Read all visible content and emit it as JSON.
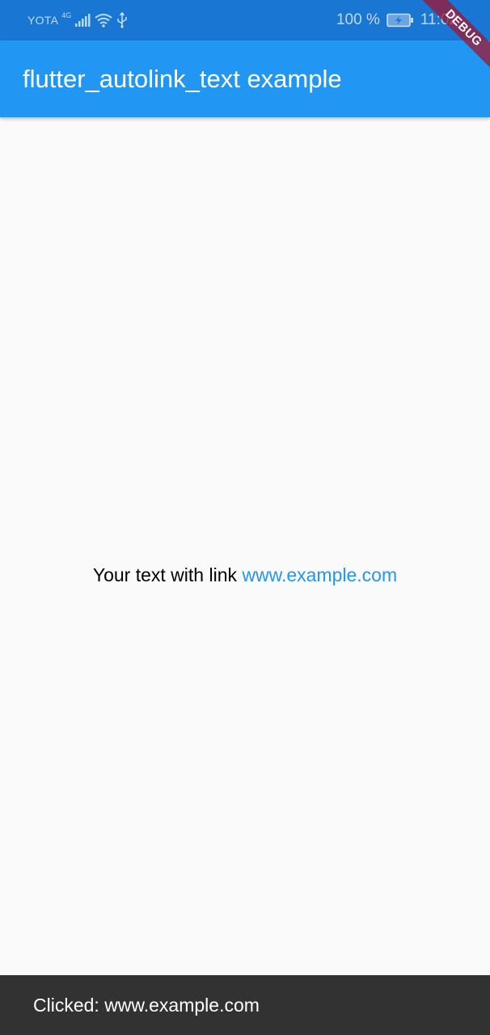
{
  "status_bar": {
    "carrier": "YOTA",
    "network_type": "4G",
    "battery_percent": "100 %",
    "time": "11:02",
    "icons": [
      "signal-icon",
      "wifi-icon",
      "usb-icon",
      "battery-charging-icon"
    ]
  },
  "app_bar": {
    "title": "flutter_autolink_text example"
  },
  "content": {
    "prefix_text": "Your text with link ",
    "link_text": "www.example.com"
  },
  "snackbar": {
    "message": "Clicked: www.example.com"
  },
  "debug_banner": {
    "label": "DEBUG"
  },
  "colors": {
    "status_bar": "#1976d2",
    "app_bar": "#2196f3",
    "link": "#2196f3",
    "background": "#fafafa",
    "snackbar": "#323232",
    "debug_banner": "#a01432"
  }
}
